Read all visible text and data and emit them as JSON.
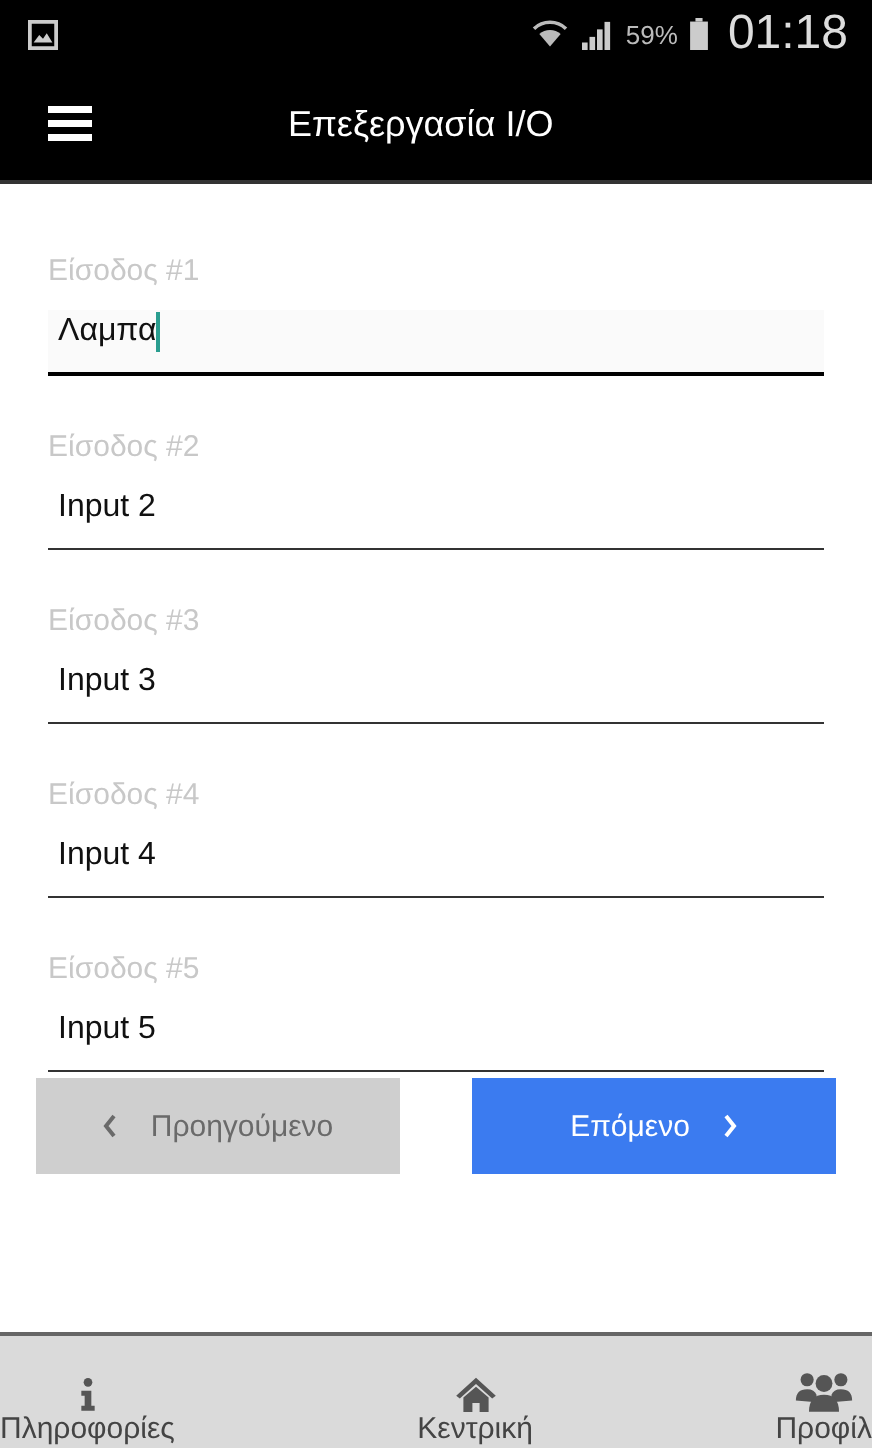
{
  "status_bar": {
    "battery": "59%",
    "time": "01:18"
  },
  "app_bar": {
    "title": "Επεξεργασία I/O"
  },
  "fields": [
    {
      "label": "Είσοδος #1",
      "value": "Λαμπα",
      "focused": true
    },
    {
      "label": "Είσοδος #2",
      "value": "Input 2",
      "focused": false
    },
    {
      "label": "Είσοδος #3",
      "value": "Input 3",
      "focused": false
    },
    {
      "label": "Είσοδος #4",
      "value": "Input 4",
      "focused": false
    },
    {
      "label": "Είσοδος #5",
      "value": "Input 5",
      "focused": false
    }
  ],
  "buttons": [
    {
      "kind": "previous",
      "label": "Προηγούμενο",
      "disabled": true
    },
    {
      "kind": "next",
      "label": "Επόμενο",
      "disabled": false
    }
  ],
  "bottom_nav": [
    {
      "kind": "info",
      "label": "Πληροφορίες"
    },
    {
      "kind": "home",
      "label": "Κεντρική"
    },
    {
      "kind": "profile",
      "label": "Προφίλ"
    }
  ]
}
